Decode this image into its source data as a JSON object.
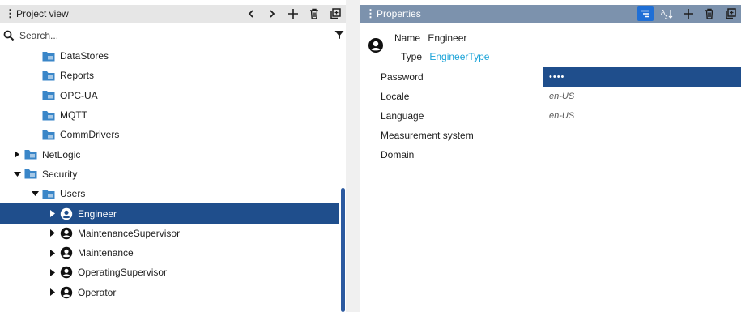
{
  "project_view": {
    "title": "Project view",
    "search_placeholder": "Search...",
    "tree": [
      {
        "label": "DataStores",
        "indent": 1,
        "expander": "none",
        "icon": "folder-icon",
        "selected": false
      },
      {
        "label": "Reports",
        "indent": 1,
        "expander": "none",
        "icon": "folder-icon",
        "selected": false
      },
      {
        "label": "OPC-UA",
        "indent": 1,
        "expander": "none",
        "icon": "folder-icon",
        "selected": false
      },
      {
        "label": "MQTT",
        "indent": 1,
        "expander": "none",
        "icon": "folder-icon",
        "selected": false
      },
      {
        "label": "CommDrivers",
        "indent": 1,
        "expander": "none",
        "icon": "folder-icon",
        "selected": false
      },
      {
        "label": "NetLogic",
        "indent": 0,
        "expander": "collapsed",
        "icon": "folder-icon",
        "selected": false
      },
      {
        "label": "Security",
        "indent": 0,
        "expander": "expanded",
        "icon": "folder-icon",
        "selected": false
      },
      {
        "label": "Users",
        "indent": 1,
        "expander": "expanded",
        "icon": "folder-icon",
        "selected": false
      },
      {
        "label": "Engineer",
        "indent": 2,
        "expander": "collapsed",
        "icon": "user-icon",
        "selected": true
      },
      {
        "label": "MaintenanceSupervisor",
        "indent": 2,
        "expander": "collapsed",
        "icon": "user-icon",
        "selected": false
      },
      {
        "label": "Maintenance",
        "indent": 2,
        "expander": "collapsed",
        "icon": "user-icon",
        "selected": false
      },
      {
        "label": "OperatingSupervisor",
        "indent": 2,
        "expander": "collapsed",
        "icon": "user-icon",
        "selected": false
      },
      {
        "label": "Operator",
        "indent": 2,
        "expander": "collapsed",
        "icon": "user-icon",
        "selected": false
      }
    ]
  },
  "properties": {
    "title": "Properties",
    "name_key": "Name",
    "name_value": "Engineer",
    "type_key": "Type",
    "type_value": "EngineerType",
    "rows": [
      {
        "key": "Password",
        "value": "••••",
        "selected": true
      },
      {
        "key": "Locale",
        "value": "en-US",
        "selected": false
      },
      {
        "key": "Language",
        "value": "en-US",
        "selected": false
      },
      {
        "key": "Measurement system",
        "value": "",
        "selected": false
      },
      {
        "key": "Domain",
        "value": "",
        "selected": false
      }
    ]
  },
  "colors": {
    "selection": "#1f4e8c",
    "properties_header": "#7c92ad",
    "active_tool": "#1f6fd6",
    "type_link": "#1aa3d8",
    "folder_blue": "#3a86c8"
  }
}
